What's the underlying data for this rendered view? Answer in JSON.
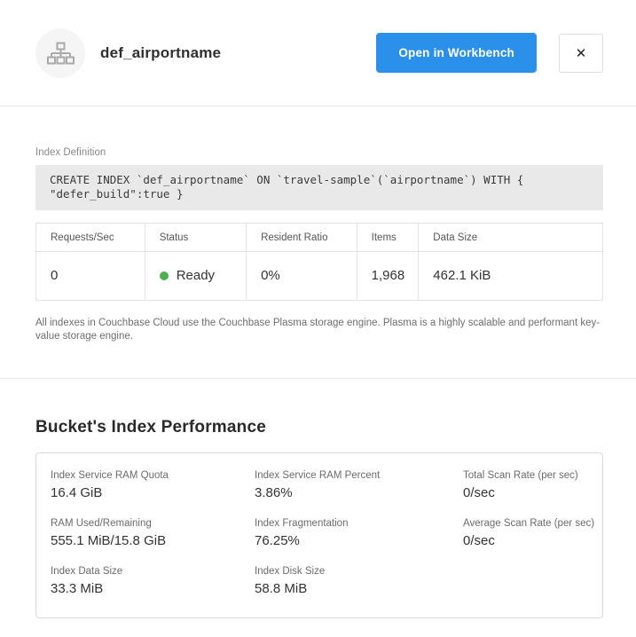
{
  "header": {
    "title": "def_airportname",
    "open_workbench_label": "Open in Workbench",
    "close_icon": "✕"
  },
  "index_definition": {
    "label": "Index Definition",
    "code": "CREATE INDEX `def_airportname` ON `travel-sample`(`airportname`) WITH {\n\"defer_build\":true }"
  },
  "stats_table": {
    "columns": [
      "Requests/Sec",
      "Status",
      "Resident Ratio",
      "Items",
      "Data Size"
    ],
    "values": [
      "0",
      "Ready",
      "0%",
      "1,968",
      "462.1 KiB"
    ]
  },
  "note": "All indexes in Couchbase Cloud use the Couchbase Plasma storage engine. Plasma is a highly scalable and performant key-value storage engine.",
  "performance": {
    "title": "Bucket's Index Performance",
    "stats": [
      {
        "label": "Index Service RAM Quota",
        "value": "16.4 GiB"
      },
      {
        "label": "Index Service RAM Percent",
        "value": "3.86%"
      },
      {
        "label": "Total Scan Rate (per sec)",
        "value": "0/sec"
      },
      {
        "label": "RAM Used/Remaining",
        "value": "555.1 MiB/15.8 GiB"
      },
      {
        "label": "Index Fragmentation",
        "value": "76.25%"
      },
      {
        "label": "Average Scan Rate (per sec)",
        "value": "0/sec"
      },
      {
        "label": "Index Data Size",
        "value": "33.3 MiB"
      },
      {
        "label": "Index Disk Size",
        "value": "58.8 MiB"
      }
    ]
  },
  "colors": {
    "accent_blue": "#2b90ea",
    "status_green": "#4caf50"
  }
}
